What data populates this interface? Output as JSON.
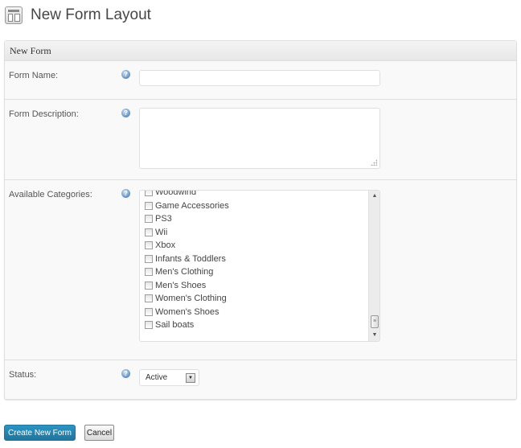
{
  "header": {
    "title": "New Form Layout",
    "icon": "layout-icon"
  },
  "panel": {
    "title": "New Form",
    "fields": {
      "form_name": {
        "label": "Form Name:",
        "value": "",
        "help_icon": "help-icon"
      },
      "form_description": {
        "label": "Form Description:",
        "value": "",
        "help_icon": "help-icon"
      },
      "available_categories": {
        "label": "Available Categories:",
        "help_icon": "help-icon",
        "items": [
          {
            "label": "Woodwind",
            "checked": false
          },
          {
            "label": "Game Accessories",
            "checked": false
          },
          {
            "label": "PS3",
            "checked": false
          },
          {
            "label": "Wii",
            "checked": false
          },
          {
            "label": "Xbox",
            "checked": false
          },
          {
            "label": "Infants & Toddlers",
            "checked": false
          },
          {
            "label": "Men's Clothing",
            "checked": false
          },
          {
            "label": "Men's Shoes",
            "checked": false
          },
          {
            "label": "Women's Clothing",
            "checked": false
          },
          {
            "label": "Women's Shoes",
            "checked": false
          },
          {
            "label": "Sail boats",
            "checked": false
          }
        ]
      },
      "status": {
        "label": "Status:",
        "selected": "Active",
        "help_icon": "help-icon"
      }
    }
  },
  "actions": {
    "create_label": "Create New Form",
    "cancel_label": "Cancel"
  },
  "colors": {
    "primary_button": "#21759b",
    "panel_bg": "#f9f9f9",
    "border": "#dfdfdf"
  },
  "glyphs": {
    "help": "?",
    "scroll_up": "▲",
    "scroll_down": "▼",
    "select_arrow": "▼",
    "thumb": "≡"
  }
}
